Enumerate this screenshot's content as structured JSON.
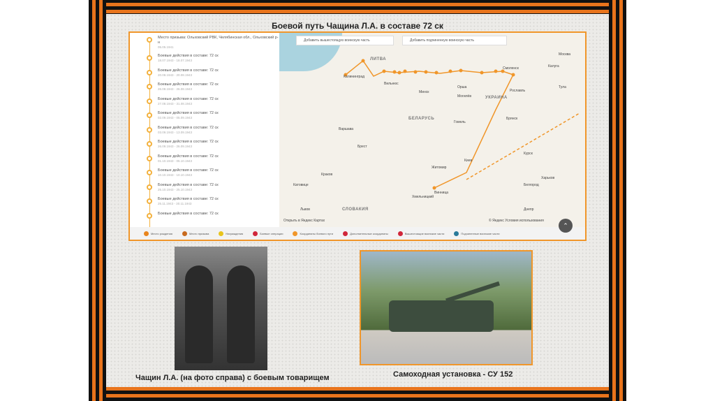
{
  "title": "Боевой путь Чащина Л.А. в составе 72 ск",
  "timeline": [
    {
      "text": "Место призыва: Ольховский РВК, Челябинская обл., Ольховский р-н",
      "date": "05.05.1941"
    },
    {
      "text": "Боевые действия в составе: 72 ск",
      "date": "18.07.1943 - 18.07.1943"
    },
    {
      "text": "Боевые действия в составе: 72 ск",
      "date": "20.08.1943 - 20.08.1943"
    },
    {
      "text": "Боевые действия в составе: 72 ск",
      "date": "26.08.1943 - 26.08.1943"
    },
    {
      "text": "Боевые действия в составе: 72 ск",
      "date": "27.08.1943 - 31.08.1943"
    },
    {
      "text": "Боевые действия в составе: 72 ск",
      "date": "02.09.1943 - 05.09.1943"
    },
    {
      "text": "Боевые действия в составе: 72 ск",
      "date": "03.09.1943 - 13.09.1943"
    },
    {
      "text": "Боевые действия в составе: 72 ск",
      "date": "26.09.1943 - 26.09.1943"
    },
    {
      "text": "Боевые действия в составе: 72 ск",
      "date": "01.10.1943 - 05.10.1943"
    },
    {
      "text": "Боевые действия в составе: 72 ск",
      "date": "10.10.1943 - 10.10.1943"
    },
    {
      "text": "Боевые действия в составе: 72 ск",
      "date": "25.10.1943 - 25.10.1943"
    },
    {
      "text": "Боевые действия в составе: 72 ск",
      "date": "25.11.1943 - 30.11.1943"
    },
    {
      "text": "Боевые действия в составе: 72 ск",
      "date": ""
    }
  ],
  "map": {
    "select_higher": "Добавить вышестоящую воинскую часть",
    "select_lower": "Добавить подчиненную воинскую часть",
    "open_yandex": "Открыть в Яндекс Картах",
    "copyright": "© Яндекс Условия использования",
    "regions": [
      "ЛИТВА",
      "БЕЛАРУСЬ",
      "УКРАИНА",
      "СЛОВАКИЯ"
    ],
    "cities": [
      "Москва",
      "Калининград",
      "Вильнюс",
      "Минск",
      "Смоленск",
      "Рославль",
      "Орша",
      "Могилёв",
      "Гомель",
      "Брест",
      "Варшава",
      "Киев",
      "Винница",
      "Житомир",
      "Брянск",
      "Курск",
      "Харьков",
      "Белгород",
      "Тула",
      "Калуга",
      "Катовице",
      "Краков",
      "Львов",
      "Хмельницкий",
      "Днепр"
    ]
  },
  "legend": [
    "Место рождения",
    "Место призыва",
    "Награждения",
    "Боевые операции",
    "Координаты боевого пути",
    "Дополнительные координаты",
    "Вышестоящие воинские части",
    "Подчиненные воинские части"
  ],
  "colors": {
    "route": "#f0962a",
    "accent": "#e8741c"
  },
  "photo_caption": "Чащин Л.А. (на фото справа) с боевым товарищем",
  "tank_caption": "Самоходная установка - СУ 152"
}
